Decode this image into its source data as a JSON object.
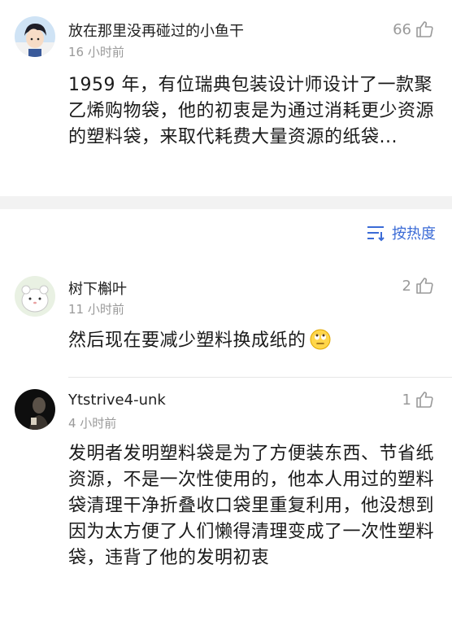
{
  "comments": [
    {
      "username": "放在那里没再碰过的小鱼干",
      "time": "16 小时前",
      "likes": "66",
      "text": "1959 年，有位瑞典包装设计师设计了一款聚乙烯购物袋，他的初衷是为通过消耗更少资源的塑料袋，来取代耗费大量资源的纸袋..."
    },
    {
      "username": "树下槲叶",
      "time": "11 小时前",
      "likes": "2",
      "text": "然后现在要减少塑料换成纸的",
      "emoji": "eye-roll-emoji"
    },
    {
      "username": "Ytstrive4-unk",
      "time": "4 小时前",
      "likes": "1",
      "text": "发明者发明塑料袋是为了方便装东西、节省纸资源，不是一次性使用的，他本人用过的塑料袋清理干净折叠收口袋里重复利用，他没想到因为太方便了人们懒得清理变成了一次性塑料袋，违背了他的发明初衷"
    }
  ],
  "sort": {
    "label": "按热度",
    "icon": "sort-icon"
  },
  "colors": {
    "accent": "#3b6bd6",
    "muted": "#9a9a9a",
    "divider": "#f2f2f2"
  }
}
